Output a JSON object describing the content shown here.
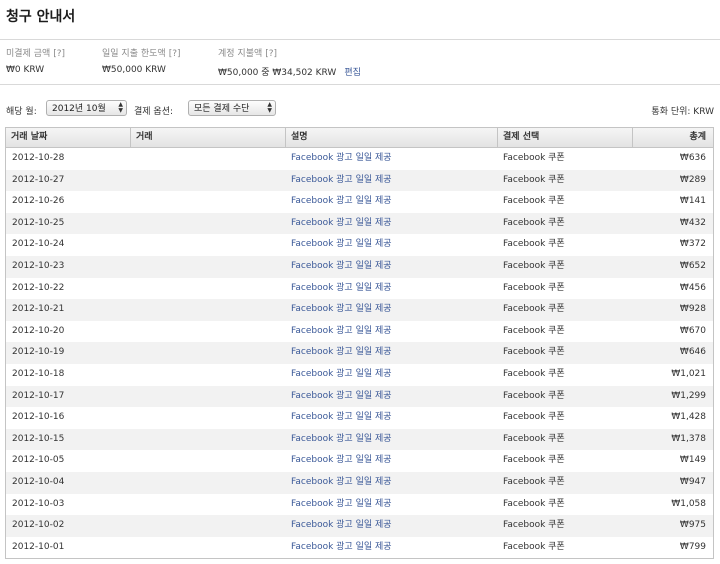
{
  "page": {
    "title": "청구 안내서"
  },
  "summary": {
    "unpaid_label": "미결제 금액",
    "unpaid_help": "[?]",
    "unpaid_value": "₩0 KRW",
    "daily_limit_label": "일일 지출 한도액",
    "daily_limit_help": "[?]",
    "daily_limit_value": "₩50,000 KRW",
    "account_limit_label": "계정 지불액",
    "account_limit_help": "[?]",
    "account_limit_value": "₩50,000 중 ₩34,502 KRW",
    "edit_label": "편집"
  },
  "filters": {
    "month_label": "해당 월:",
    "month_value": "2012년 10월",
    "payment_label": "결제 옵션:",
    "payment_value": "모든 결제 수단",
    "currency_label": "통화 단위: KRW"
  },
  "table": {
    "headers": {
      "date": "거래 날짜",
      "transaction": "거래",
      "description": "설명",
      "payment": "결제 선택",
      "total": "총계"
    },
    "rows": [
      {
        "date": "2012-10-28",
        "description": "Facebook 광고 일일 제공",
        "payment": "Facebook 쿠폰",
        "amount": "₩636"
      },
      {
        "date": "2012-10-27",
        "description": "Facebook 광고 일일 제공",
        "payment": "Facebook 쿠폰",
        "amount": "₩289"
      },
      {
        "date": "2012-10-26",
        "description": "Facebook 광고 일일 제공",
        "payment": "Facebook 쿠폰",
        "amount": "₩141"
      },
      {
        "date": "2012-10-25",
        "description": "Facebook 광고 일일 제공",
        "payment": "Facebook 쿠폰",
        "amount": "₩432"
      },
      {
        "date": "2012-10-24",
        "description": "Facebook 광고 일일 제공",
        "payment": "Facebook 쿠폰",
        "amount": "₩372"
      },
      {
        "date": "2012-10-23",
        "description": "Facebook 광고 일일 제공",
        "payment": "Facebook 쿠폰",
        "amount": "₩652"
      },
      {
        "date": "2012-10-22",
        "description": "Facebook 광고 일일 제공",
        "payment": "Facebook 쿠폰",
        "amount": "₩456"
      },
      {
        "date": "2012-10-21",
        "description": "Facebook 광고 일일 제공",
        "payment": "Facebook 쿠폰",
        "amount": "₩928"
      },
      {
        "date": "2012-10-20",
        "description": "Facebook 광고 일일 제공",
        "payment": "Facebook 쿠폰",
        "amount": "₩670"
      },
      {
        "date": "2012-10-19",
        "description": "Facebook 광고 일일 제공",
        "payment": "Facebook 쿠폰",
        "amount": "₩646"
      },
      {
        "date": "2012-10-18",
        "description": "Facebook 광고 일일 제공",
        "payment": "Facebook 쿠폰",
        "amount": "₩1,021"
      },
      {
        "date": "2012-10-17",
        "description": "Facebook 광고 일일 제공",
        "payment": "Facebook 쿠폰",
        "amount": "₩1,299"
      },
      {
        "date": "2012-10-16",
        "description": "Facebook 광고 일일 제공",
        "payment": "Facebook 쿠폰",
        "amount": "₩1,428"
      },
      {
        "date": "2012-10-15",
        "description": "Facebook 광고 일일 제공",
        "payment": "Facebook 쿠폰",
        "amount": "₩1,378"
      },
      {
        "date": "2012-10-05",
        "description": "Facebook 광고 일일 제공",
        "payment": "Facebook 쿠폰",
        "amount": "₩149"
      },
      {
        "date": "2012-10-04",
        "description": "Facebook 광고 일일 제공",
        "payment": "Facebook 쿠폰",
        "amount": "₩947"
      },
      {
        "date": "2012-10-03",
        "description": "Facebook 광고 일일 제공",
        "payment": "Facebook 쿠폰",
        "amount": "₩1,058"
      },
      {
        "date": "2012-10-02",
        "description": "Facebook 광고 일일 제공",
        "payment": "Facebook 쿠폰",
        "amount": "₩975"
      },
      {
        "date": "2012-10-01",
        "description": "Facebook 광고 일일 제공",
        "payment": "Facebook 쿠폰",
        "amount": "₩799"
      }
    ]
  }
}
